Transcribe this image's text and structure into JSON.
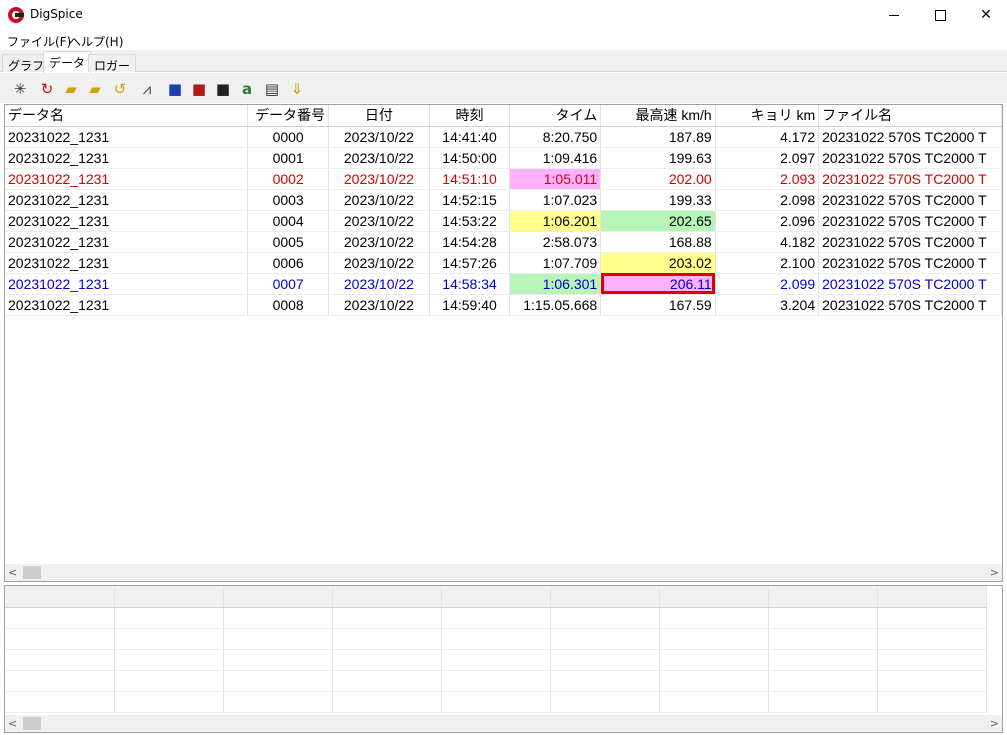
{
  "window": {
    "title": "DigSpice",
    "icon": "digspice-logo-icon"
  },
  "menu": {
    "items": [
      "ファイル(F)",
      "ヘルプ(H)"
    ]
  },
  "tabs": [
    {
      "label": "グラフ",
      "active": false
    },
    {
      "label": "データ",
      "active": true
    },
    {
      "label": "ロガー",
      "active": false
    }
  ],
  "toolbar": {
    "icons": [
      "sparkle-icon",
      "refresh-icon",
      "open-folder-icon",
      "open-folder-plus-icon",
      "rotate-icon",
      "chart-icon",
      "save-blue-icon",
      "save-red-icon",
      "save-black-icon",
      "text-edit-icon",
      "waveform-icon",
      "download-icon"
    ]
  },
  "grid": {
    "columns": [
      "データ名",
      "データ番号",
      "日付",
      "時刻",
      "タイム",
      "最高速 km/h",
      "キョリ km",
      "ファイル名"
    ],
    "rows": [
      {
        "name": "20231022_1231",
        "num": "0000",
        "date": "2023/10/22",
        "time": "14:41:40",
        "lap": "8:20.750",
        "speed": "187.89",
        "dist": "4.172",
        "file": "20231022 570S TC2000 T",
        "color": "",
        "lap_hl": "",
        "speed_hl": ""
      },
      {
        "name": "20231022_1231",
        "num": "0001",
        "date": "2023/10/22",
        "time": "14:50:00",
        "lap": "1:09.416",
        "speed": "199.63",
        "dist": "2.097",
        "file": "20231022 570S TC2000 T",
        "color": "",
        "lap_hl": "",
        "speed_hl": ""
      },
      {
        "name": "20231022_1231",
        "num": "0002",
        "date": "2023/10/22",
        "time": "14:51:10",
        "lap": "1:05.011",
        "speed": "202.00",
        "dist": "2.093",
        "file": "20231022 570S TC2000 T",
        "color": "red",
        "lap_hl": "pink",
        "speed_hl": ""
      },
      {
        "name": "20231022_1231",
        "num": "0003",
        "date": "2023/10/22",
        "time": "14:52:15",
        "lap": "1:07.023",
        "speed": "199.33",
        "dist": "2.098",
        "file": "20231022 570S TC2000 T",
        "color": "",
        "lap_hl": "",
        "speed_hl": ""
      },
      {
        "name": "20231022_1231",
        "num": "0004",
        "date": "2023/10/22",
        "time": "14:53:22",
        "lap": "1:06.201",
        "speed": "202.65",
        "dist": "2.096",
        "file": "20231022 570S TC2000 T",
        "color": "",
        "lap_hl": "yellow",
        "speed_hl": "green"
      },
      {
        "name": "20231022_1231",
        "num": "0005",
        "date": "2023/10/22",
        "time": "14:54:28",
        "lap": "2:58.073",
        "speed": "168.88",
        "dist": "4.182",
        "file": "20231022 570S TC2000 T",
        "color": "",
        "lap_hl": "",
        "speed_hl": ""
      },
      {
        "name": "20231022_1231",
        "num": "0006",
        "date": "2023/10/22",
        "time": "14:57:26",
        "lap": "1:07.709",
        "speed": "203.02",
        "dist": "2.100",
        "file": "20231022 570S TC2000 T",
        "color": "",
        "lap_hl": "",
        "speed_hl": "yellow"
      },
      {
        "name": "20231022_1231",
        "num": "0007",
        "date": "2023/10/22",
        "time": "14:58:34",
        "lap": "1:06.301",
        "speed": "206.11",
        "dist": "2.099",
        "file": "20231022 570S TC2000 T",
        "color": "blue",
        "lap_hl": "green",
        "speed_hl": "selected"
      },
      {
        "name": "20231022_1231",
        "num": "0008",
        "date": "2023/10/22",
        "time": "14:59:40",
        "lap": "1:15.05.668",
        "speed": "167.59",
        "dist": "3.204",
        "file": "20231022 570S TC2000 T",
        "color": "",
        "lap_hl": "",
        "speed_hl": ""
      }
    ]
  },
  "colors": {
    "red_row": "#d40000",
    "blue_row": "#0000cc",
    "pink": "#ffb0ff",
    "yellow": "#ffff8c",
    "green": "#b6f5b6",
    "selection_border": "#e00000"
  }
}
